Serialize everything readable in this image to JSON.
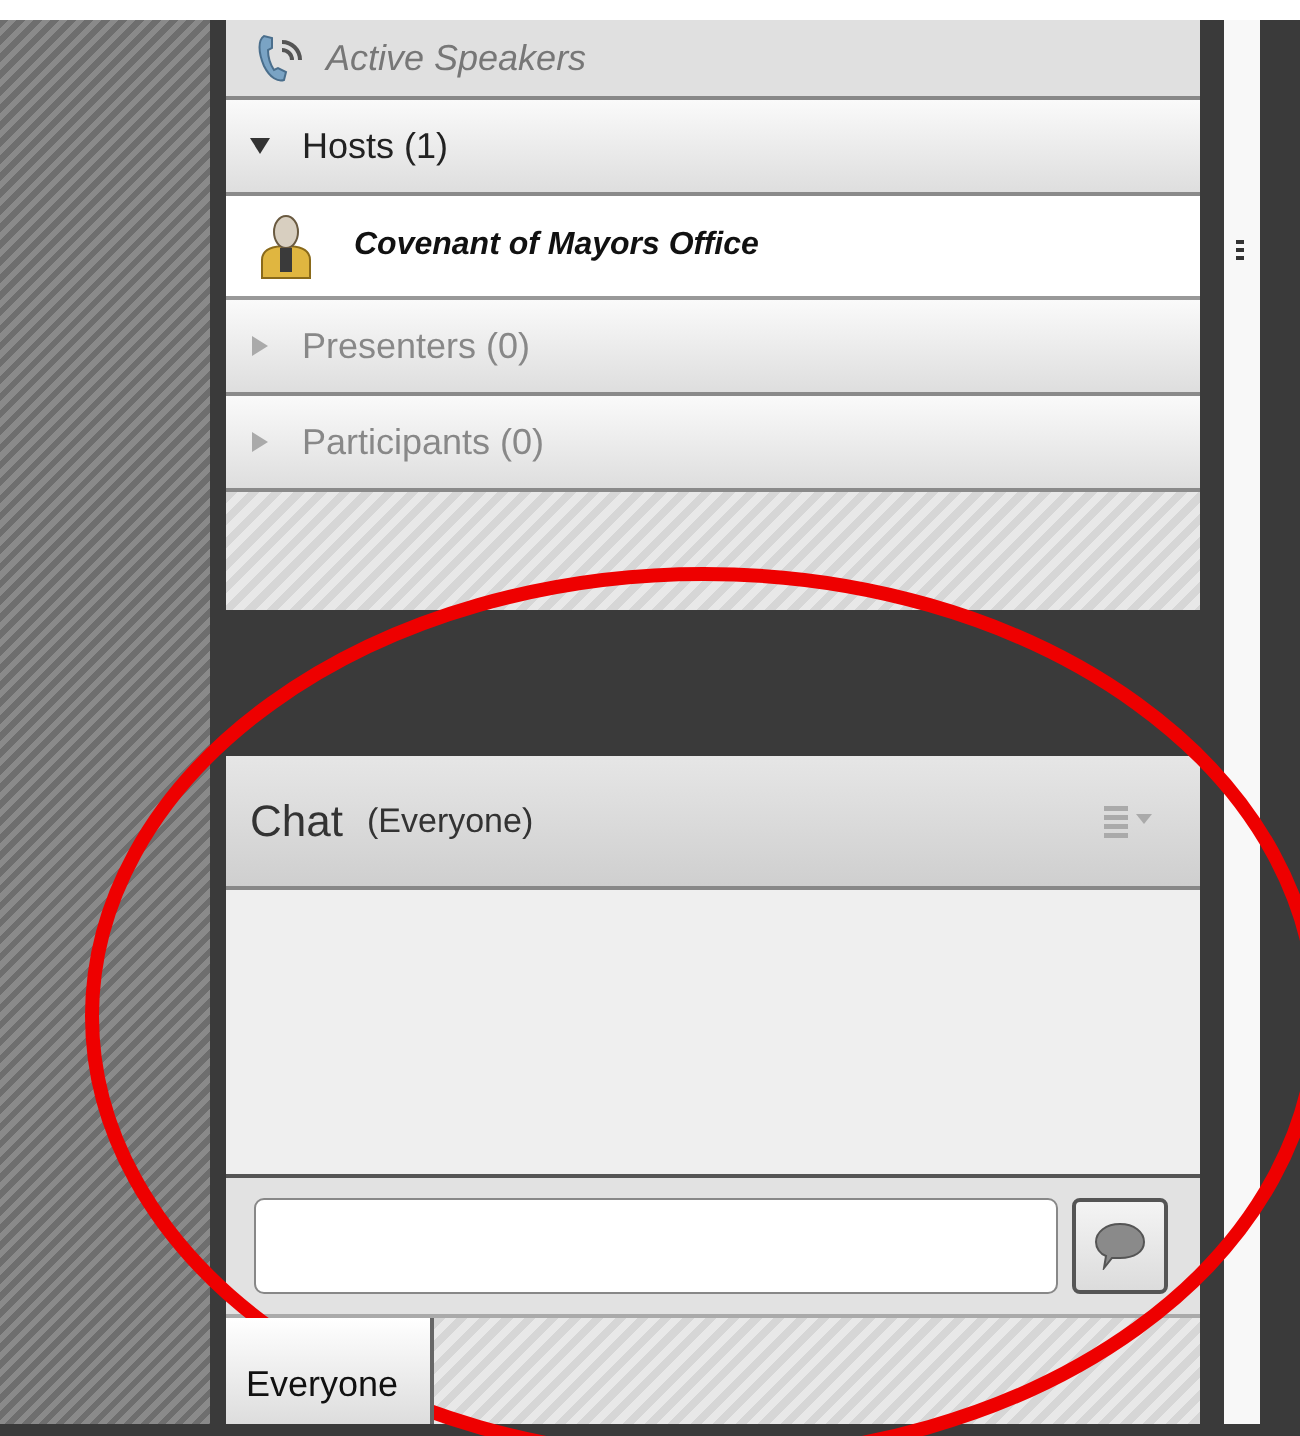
{
  "attendees": {
    "active_speakers": "Active Speakers",
    "groups": [
      {
        "label": "Hosts (1)",
        "expanded": true,
        "disabled": false,
        "members": [
          "Covenant of Mayors Office"
        ]
      },
      {
        "label": "Presenters (0)",
        "expanded": false,
        "disabled": true
      },
      {
        "label": "Participants (0)",
        "expanded": false,
        "disabled": true
      }
    ]
  },
  "chat": {
    "title": "Chat",
    "audience": "(Everyone)",
    "tabs": [
      {
        "label": "Everyone",
        "selected": true
      }
    ]
  }
}
